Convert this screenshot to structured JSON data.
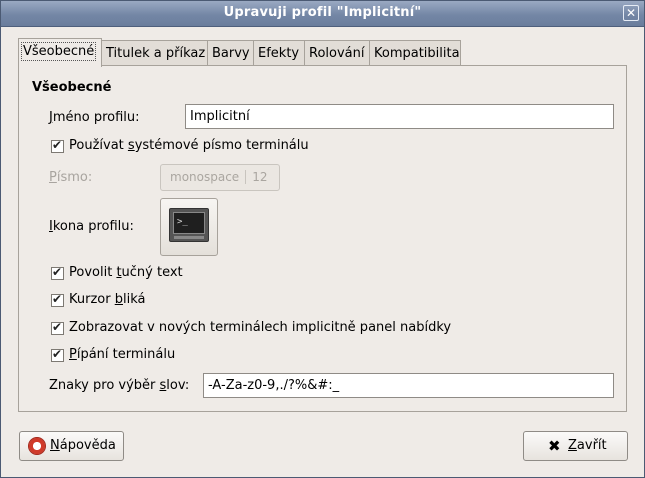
{
  "window": {
    "title": "Upravuji profil \"Implicitní\"",
    "close_symbol": "✕"
  },
  "tabs": [
    {
      "label": "Všeobecné"
    },
    {
      "label": "Titulek a příkaz"
    },
    {
      "label": "Barvy"
    },
    {
      "label": "Efekty"
    },
    {
      "label": "Rolování"
    },
    {
      "label": "Kompatibilita"
    }
  ],
  "general": {
    "section_title": "Všeobecné",
    "profile_name": {
      "label_pre": "",
      "label_u": "J",
      "label_post": "méno profilu:",
      "value": "Implicitní"
    },
    "system_font": {
      "label_pre": "Používat ",
      "label_u": "s",
      "label_post": "ystémové písmo terminálu",
      "checked": true
    },
    "font": {
      "label_pre": "",
      "label_u": "P",
      "label_post": "ísmo:",
      "family": "monospace",
      "size": "12"
    },
    "profile_icon": {
      "label_pre": "",
      "label_u": "I",
      "label_post": "kona profilu:",
      "icon": "terminal-icon",
      "prompt": ">_"
    },
    "bold_text": {
      "label_pre": "Povolit ",
      "label_u": "t",
      "label_post": "učný text",
      "checked": true
    },
    "cursor_blink": {
      "label_pre": "Kurzor ",
      "label_u": "b",
      "label_post": "liká",
      "checked": true
    },
    "menubar": {
      "label_pre": "Zobrazovat v nových terminálech implicitně panel nabídky",
      "checked": true
    },
    "bell": {
      "label_pre": "",
      "label_u": "P",
      "label_post": "ípání terminálu",
      "checked": true
    },
    "word_chars": {
      "label_pre": "Znaky pro výběr ",
      "label_u": "s",
      "label_post": "lov:",
      "value": "-A-Za-z0-9,./?%&#:_"
    }
  },
  "buttons": {
    "help": {
      "label_u": "N",
      "label_post": "ápověda",
      "icon": "lifebuoy-icon"
    },
    "close": {
      "label_u": "Z",
      "label_post": "avřít",
      "icon": "close-x-icon",
      "symbol": "✖"
    }
  }
}
